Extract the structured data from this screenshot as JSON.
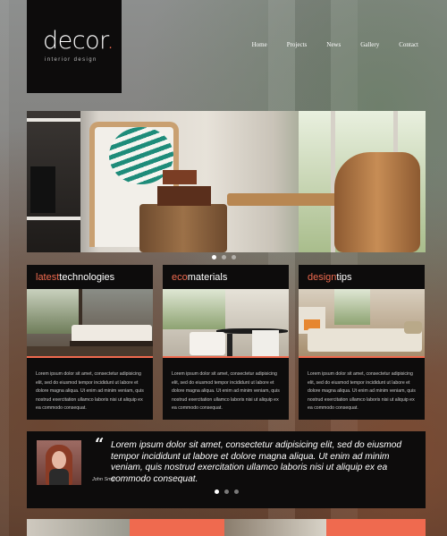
{
  "brand": {
    "name": "decor",
    "dot": ".",
    "tagline": "interior design",
    "accent": "#ef6a4f"
  },
  "nav": [
    "Home",
    "Projects",
    "News",
    "Gallery",
    "Contact"
  ],
  "hero": {
    "slide_count": 3,
    "active_slide": 1
  },
  "cards": [
    {
      "title_accent": "latest",
      "title_rest": "technologies",
      "text": "Lorem ipsum dolor sit amet, consectetur adipisicing elit, sed do eiusmod tempor incididunt ut labore et dolore magna aliqua. Ut enim ad minim veniam, quis nostrud exercitation ullamco laboris nisi ut aliquip ex ea commodo consequat."
    },
    {
      "title_accent": "eco",
      "title_rest": "materials",
      "text": "Lorem ipsum dolor sit amet, consectetur adipisicing elit, sed do eiusmod tempor incididunt ut labore et dolore magna aliqua. Ut enim ad minim veniam, quis nostrud exercitation ullamco laboris nisi ut aliquip ex ea commodo consequat."
    },
    {
      "title_accent": "design",
      "title_rest": "tips",
      "text": "Lorem ipsum dolor sit amet, consectetur adipisicing elit, sed do eiusmod tempor incididunt ut labore et dolore magna aliqua. Ut enim ad minim veniam, quis nostrud exercitation ullamco laboris nisi ut aliquip ex ea commodo consequat."
    }
  ],
  "testimonial": {
    "quote_mark": "“",
    "quote": "Lorem ipsum dolor sit amet, consectetur adipisicing elit, sed do eiusmod tempor incididunt ut labore et dolore magna aliqua. Ut enim ad minim veniam, quis nostrud exercitation ullamco laboris nisi ut aliquip ex ea commodo consequat.",
    "author": "John Smith",
    "slide_count": 3,
    "active_slide": 1
  },
  "icons": {
    "quote": "quote-icon"
  }
}
